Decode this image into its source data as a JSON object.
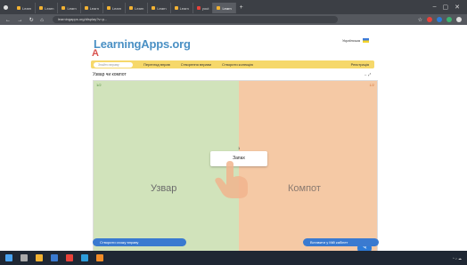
{
  "browser": {
    "tabs": [
      {
        "label": "Learn",
        "style": "normal"
      },
      {
        "label": "Learn",
        "style": "normal"
      },
      {
        "label": "Learn",
        "style": "normal"
      },
      {
        "label": "Learn",
        "style": "normal"
      },
      {
        "label": "Learn",
        "style": "normal"
      },
      {
        "label": "Learn",
        "style": "normal"
      },
      {
        "label": "Learn",
        "style": "normal"
      },
      {
        "label": "Learn",
        "style": "normal"
      },
      {
        "label": "yout",
        "style": "red"
      },
      {
        "label": "Learn",
        "style": "active"
      }
    ],
    "new_tab": "+",
    "url": "learningapps.org/display?v=p..."
  },
  "site": {
    "logo": "LearningApps.org",
    "language": "Українська",
    "search_placeholder": "Знайти вправу",
    "menu": {
      "browse": "Перегляд вправ",
      "create": "Створення вправи",
      "my_apps": "Створити колекцію",
      "register": "Реєстрація"
    }
  },
  "app": {
    "title": "Узвар чи компот",
    "controls": "↔ ⤢",
    "left_label": "Узвар",
    "right_label": "Компот",
    "left_corner": "1/2",
    "right_corner": "1/2",
    "card_text": "Запах",
    "card_counter": "1",
    "fab_icon": "✎"
  },
  "footer": {
    "create_similar": "Створити схожу вправу",
    "embed": "Вставити у Мій кабінет"
  },
  "colors": {
    "left_zone": "#d1e3bb",
    "right_zone": "#f5c9a5",
    "accent": "#3a7ad0"
  }
}
